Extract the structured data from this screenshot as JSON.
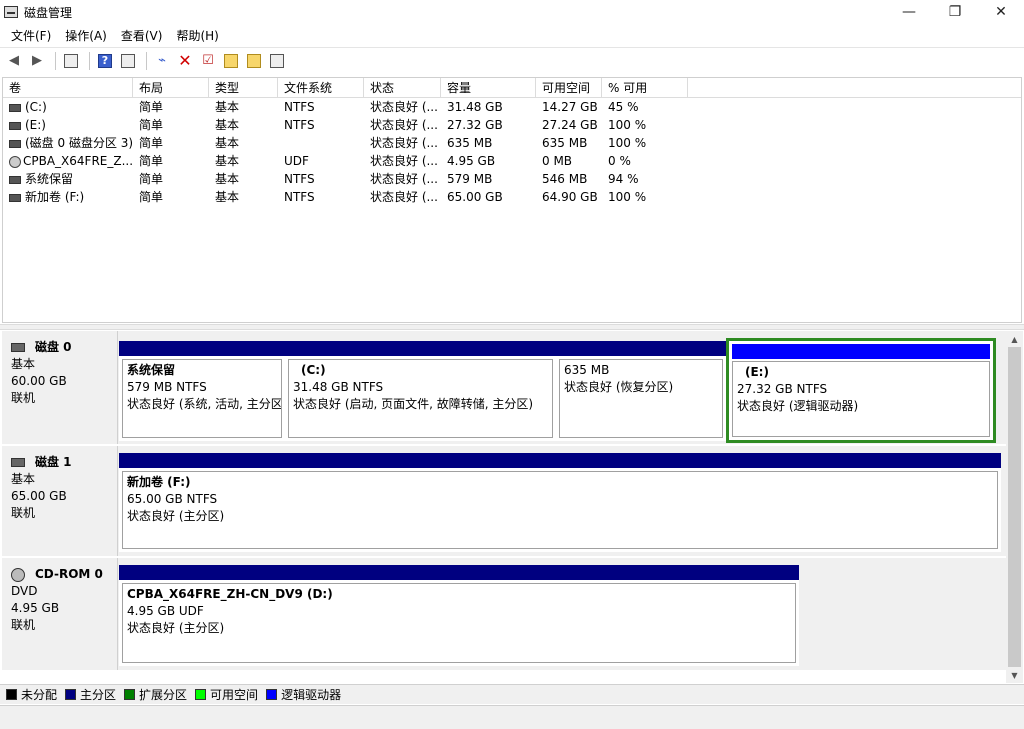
{
  "window": {
    "title": "磁盘管理"
  },
  "menu": [
    "文件(F)",
    "操作(A)",
    "查看(V)",
    "帮助(H)"
  ],
  "columns": [
    "卷",
    "布局",
    "类型",
    "文件系统",
    "状态",
    "容量",
    "可用空间",
    "% 可用"
  ],
  "volumes": [
    {
      "name": "(C:)",
      "layout": "简单",
      "type": "基本",
      "fs": "NTFS",
      "status": "状态良好 (...",
      "capacity": "31.48 GB",
      "free": "14.27 GB",
      "pct": "45 %"
    },
    {
      "name": "(E:)",
      "layout": "简单",
      "type": "基本",
      "fs": "NTFS",
      "status": "状态良好 (...",
      "capacity": "27.32 GB",
      "free": "27.24 GB",
      "pct": "100 %"
    },
    {
      "name": "(磁盘 0 磁盘分区 3)",
      "layout": "简单",
      "type": "基本",
      "fs": "",
      "status": "状态良好 (...",
      "capacity": "635 MB",
      "free": "635 MB",
      "pct": "100 %"
    },
    {
      "name": "CPBA_X64FRE_Z...",
      "layout": "简单",
      "type": "基本",
      "fs": "UDF",
      "status": "状态良好 (...",
      "capacity": "4.95 GB",
      "free": "0 MB",
      "pct": "0 %"
    },
    {
      "name": "系统保留",
      "layout": "简单",
      "type": "基本",
      "fs": "NTFS",
      "status": "状态良好 (...",
      "capacity": "579 MB",
      "free": "546 MB",
      "pct": "94 %"
    },
    {
      "name": "新加卷 (F:)",
      "layout": "简单",
      "type": "基本",
      "fs": "NTFS",
      "status": "状态良好 (...",
      "capacity": "65.00 GB",
      "free": "64.90 GB",
      "pct": "100 %"
    }
  ],
  "disks": [
    {
      "name": "磁盘 0",
      "kind": "基本",
      "size": "60.00 GB",
      "state": "联机",
      "partitions": [
        {
          "name": "系统保留",
          "line2": "579 MB NTFS",
          "line3": "状态良好 (系统, 活动, 主分区)"
        },
        {
          "name": "(C:)",
          "line2": "31.48 GB NTFS",
          "line3": "状态良好 (启动, 页面文件, 故障转储, 主分区)"
        },
        {
          "name": "",
          "line2": "635 MB",
          "line3": "状态良好 (恢复分区)"
        },
        {
          "name": "(E:)",
          "line2": "27.32 GB NTFS",
          "line3": "状态良好 (逻辑驱动器)"
        }
      ]
    },
    {
      "name": "磁盘 1",
      "kind": "基本",
      "size": "65.00 GB",
      "state": "联机",
      "partitions": [
        {
          "name": "新加卷  (F:)",
          "line2": "65.00 GB NTFS",
          "line3": "状态良好 (主分区)"
        }
      ]
    },
    {
      "name": "CD-ROM 0",
      "kind": "DVD",
      "size": "4.95 GB",
      "state": "联机",
      "partitions": [
        {
          "name": "CPBA_X64FRE_ZH-CN_DV9  (D:)",
          "line2": "4.95 GB UDF",
          "line3": "状态良好 (主分区)"
        }
      ]
    }
  ],
  "legend": [
    {
      "label": "未分配",
      "color": "#000000"
    },
    {
      "label": "主分区",
      "color": "#000080"
    },
    {
      "label": "扩展分区",
      "color": "#008000"
    },
    {
      "label": "可用空间",
      "color": "#00ff00"
    },
    {
      "label": "逻辑驱动器",
      "color": "#0000ff"
    }
  ],
  "colors": {
    "primary": "#000080",
    "logical": "#0000ff",
    "selected": "#2e8b22"
  }
}
